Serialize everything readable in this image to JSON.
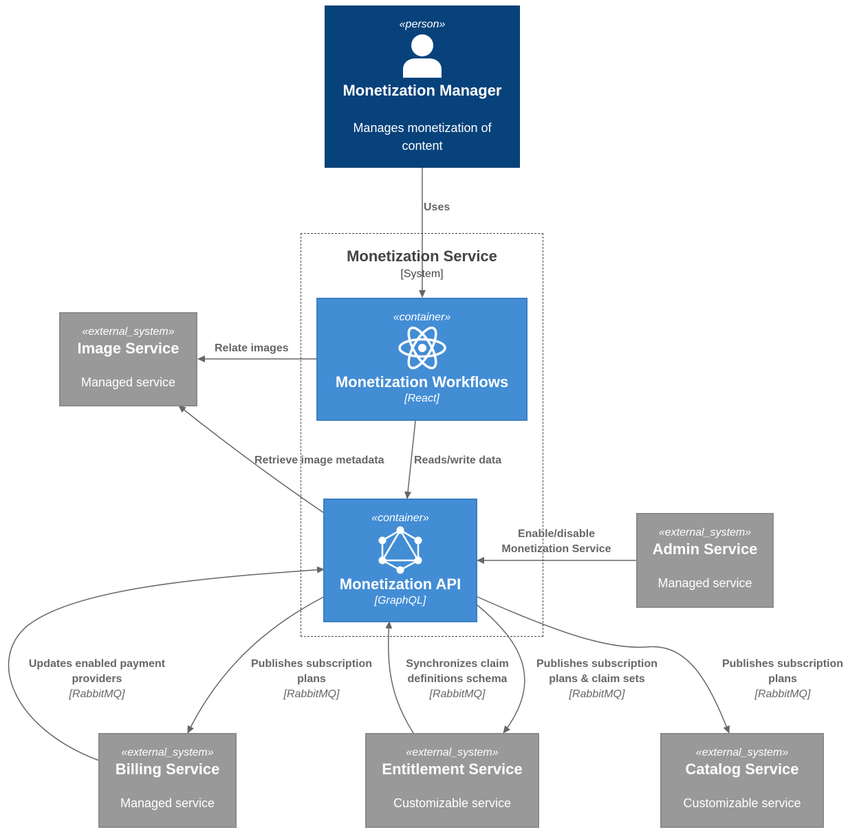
{
  "diagram": {
    "boundary": {
      "title": "Monetization Service",
      "subtitle": "[System]"
    },
    "nodes": {
      "manager": {
        "stereotype": "«person»",
        "icon": "person-icon",
        "title": "Monetization Manager",
        "description_line1": "Manages monetization of",
        "description_line2": "content",
        "color": "#08427b"
      },
      "workflows": {
        "stereotype": "«container»",
        "icon": "react-icon",
        "title": "Monetization Workflows",
        "technology": "[React]",
        "color": "#438dd5"
      },
      "api": {
        "stereotype": "«container»",
        "icon": "graphql-icon",
        "title": "Monetization API",
        "technology": "[GraphQL]",
        "color": "#438dd5"
      },
      "image": {
        "stereotype": "«external_system»",
        "title": "Image Service",
        "description": "Managed service",
        "color": "#999999"
      },
      "admin": {
        "stereotype": "«external_system»",
        "title": "Admin Service",
        "description": "Managed service",
        "color": "#999999"
      },
      "billing": {
        "stereotype": "«external_system»",
        "title": "Billing Service",
        "description": "Managed service",
        "color": "#999999"
      },
      "entitlement": {
        "stereotype": "«external_system»",
        "title": "Entitlement Service",
        "description": "Customizable service",
        "color": "#999999"
      },
      "catalog": {
        "stereotype": "«external_system»",
        "title": "Catalog Service",
        "description": "Customizable service",
        "color": "#999999"
      }
    },
    "edges": {
      "uses": {
        "from": "Monetization Manager",
        "to": "Monetization Workflows",
        "label": "Uses"
      },
      "relate_images": {
        "from": "Monetization Workflows",
        "to": "Image Service",
        "label": "Relate images"
      },
      "reads_write": {
        "from": "Monetization Workflows",
        "to": "Monetization API",
        "label": "Reads/write data"
      },
      "retrieve_meta": {
        "from": "Monetization API",
        "to": "Image Service",
        "label": "Retrieve image metadata"
      },
      "enable_disable": {
        "from": "Admin Service",
        "to": "Monetization API",
        "label_line1": "Enable/disable",
        "label_line2": "Monetization Service"
      },
      "updates_payment": {
        "from": "Billing Service",
        "to": "Monetization API",
        "label_line1": "Updates enabled payment",
        "label_line2": "providers",
        "technology": "[RabbitMQ]"
      },
      "publish_billing": {
        "from": "Monetization API",
        "to": "Billing Service",
        "label_line1": "Publishes subscription",
        "label_line2": "plans",
        "technology": "[RabbitMQ]"
      },
      "sync_claims": {
        "from": "Entitlement Service",
        "to": "Monetization API",
        "label_line1": "Synchronizes claim",
        "label_line2": "definitions schema",
        "technology": "[RabbitMQ]"
      },
      "publish_entitlement": {
        "from": "Monetization API",
        "to": "Entitlement Service",
        "label_line1": "Publishes subscription",
        "label_line2": "plans & claim sets",
        "technology": "[RabbitMQ]"
      },
      "publish_catalog": {
        "from": "Monetization API",
        "to": "Catalog Service",
        "label_line1": "Publishes subscription",
        "label_line2": "plans",
        "technology": "[RabbitMQ]"
      }
    },
    "edge_color": "#666666"
  }
}
